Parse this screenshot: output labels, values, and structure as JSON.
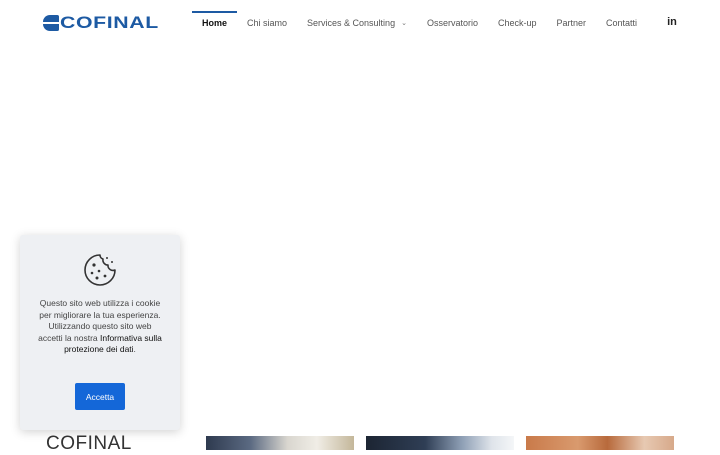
{
  "header": {
    "logo_text": "COFINAL",
    "nav": [
      {
        "label": "Home",
        "active": true
      },
      {
        "label": "Chi siamo"
      },
      {
        "label": "Services & Consulting",
        "has_dropdown": true
      },
      {
        "label": "Osservatorio"
      },
      {
        "label": "Check-up"
      },
      {
        "label": "Partner"
      },
      {
        "label": "Contatti"
      }
    ],
    "social_icon": "linkedin-icon",
    "social_label": "in"
  },
  "cookie_banner": {
    "icon": "cookie-icon",
    "text": "Questo sito web utilizza i cookie per migliorare la tua esperienza. Utilizzando questo sito web accetti la nostra",
    "link_text": "Informativa sulla protezione dei dati",
    "text_end": ".",
    "accept_label": "Accetta"
  },
  "main": {
    "heading": "COFINAL"
  },
  "colors": {
    "brand": "#1d5aa3",
    "button": "#1467d8",
    "cookie_bg": "#eef0f3"
  }
}
